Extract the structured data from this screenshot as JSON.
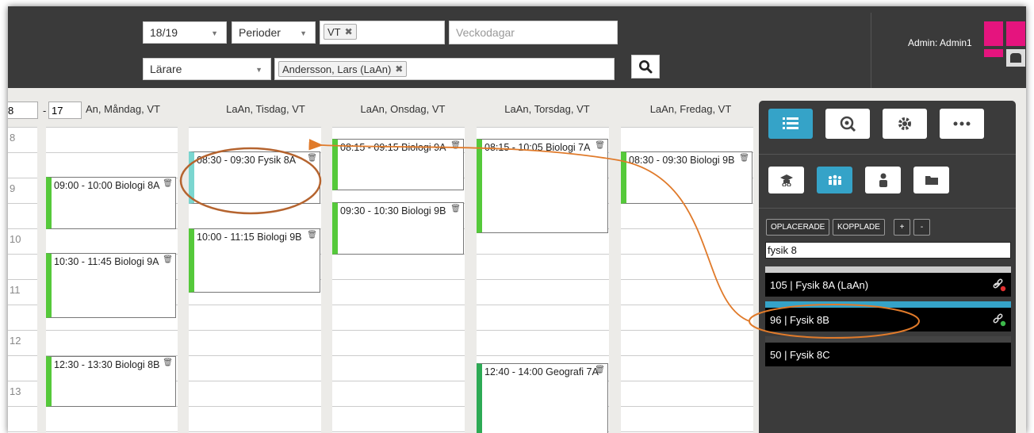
{
  "header": {
    "year_select": "18/19",
    "period_select": "Perioder",
    "period_tag": "VT",
    "weekdays_placeholder": "Veckodagar",
    "role_select": "Lärare",
    "teacher_tag": "Andersson, Lars (LaAn)",
    "admin_label": "Admin: Admin1"
  },
  "calendar": {
    "hour_from": "8",
    "hour_to": "17",
    "days": [
      {
        "label": "LaAn, Måndag, VT",
        "display": "An, Måndag, VT"
      },
      {
        "label": "LaAn, Tisdag, VT"
      },
      {
        "label": "LaAn, Onsdag, VT"
      },
      {
        "label": "LaAn, Torsdag, VT"
      },
      {
        "label": "LaAn, Fredag, VT"
      }
    ],
    "hours": [
      "8",
      "9",
      "10",
      "11",
      "12",
      "13"
    ],
    "events": {
      "mon": [
        "09:00 - 10:00 Biologi 8A",
        "10:30 - 11:45 Biologi 9A",
        "12:30 - 13:30 Biologi 8B"
      ],
      "tue": [
        "08:30 - 09:30 Fysik 8A",
        "10:00 - 11:15 Biologi 9B"
      ],
      "wed": [
        "08:15 - 09:15 Biologi 9A",
        "09:30 - 10:30 Biologi 9B"
      ],
      "thu": [
        "08:15 - 10:05 Biologi 7A",
        "12:40 - 14:00 Geografi 7A"
      ],
      "fri": [
        "08:30 - 09:30 Biologi 9B"
      ]
    }
  },
  "panel": {
    "tabs": [
      "OPLACERADE",
      "KOPPLADE",
      "+",
      "-"
    ],
    "filter_value": "fysik 8",
    "courses": [
      "105 | Fysik 8A (LaAn)",
      "96 | Fysik 8B",
      "50 | Fysik 8C"
    ]
  },
  "colors": {
    "header_bg": "#3a3a3a",
    "accent": "#35a3c8",
    "event_green": "#55c93a",
    "event_teal": "#7bd6d0",
    "annotation_orange": "#e07a2a",
    "brand_pink": "#e5147e"
  }
}
